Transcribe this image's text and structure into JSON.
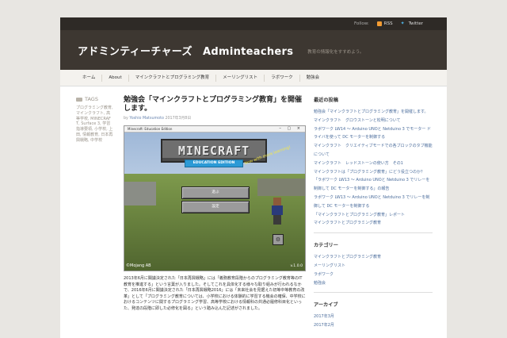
{
  "topbar": {
    "follow_label": "Follow:",
    "rss_label": "RSS",
    "twitter_label": "Twitter"
  },
  "header": {
    "title": "アドミンティーチャーズ　Adminteachers",
    "tagline": "教育の情報化をすすめよう。"
  },
  "nav": {
    "items": [
      "ホーム",
      "About",
      "マインクラフトとプログラミング教育",
      "メーリングリスト",
      "ラボワーク",
      "勉強会"
    ]
  },
  "tags": {
    "heading": "TAGS",
    "text": "プログラミング教育, マインクラフト, 高等学校, MINECRAFT, Surface 3, 学習指導要領, 小学校, 上田, 情報教育, 日本再興戦略, 中学校"
  },
  "post": {
    "title": "勉強会「マインクラフトとプログラミング教育」を開催します。",
    "meta_by": "by",
    "author": "Yoshio Matsumoto",
    "date": "2017年3月8日",
    "screenshot": {
      "window_title": "Minecraft: Education Edition",
      "logo_text": "MINECRAFT",
      "edition_text": "EDUCATION EDITION",
      "splash_text": "Now with more learning!",
      "play_button": "遊ぶ",
      "settings_button": "設定",
      "credit": "©Mojang AB",
      "version": "v.1.0.0"
    },
    "body": "2013年6月に閣議決定された「日本再興戦略」には「義務教育段階からのプログラミング教育等のIT教育を推進する」という言葉が入りました。そしてこれを具体化する様々な取り組みが行われるなかで、2016年6月に閣議決定された「日本再興戦略2016」には「未来社会を見据えた初等中等教育の改革」として「プログラミング教育については、小学校における体験的に学習する機会の確保、中学校におけるコンテンツに関するプログラミング学習、高等学校における情報科の共通必履修科目化といった、発達の段階に即した必修化を図る」という踏み込んだ記述がされました。"
  },
  "sidebar": {
    "recent_heading": "最近の投稿",
    "recent": [
      "勉強会「マインクラフトとプログラミング教育」を開催します。",
      "マインクラフト　グロウストーンと松明について",
      "ラボワーク LW14 ～ Arduino UNOと Netduino 3 でモーター ドライバを使って DC モーターを制御する",
      "マインクラフト　クリエイティブモードでの各ブロックのタブ機能について",
      "マインクラフト　レッドストーンの使い方　その1",
      "マインクラフトは「プログラミング教育」にどう役立つのか？",
      "「ラボワーク LW13 ～ Arduino UNOと Netduino 3 でリレーを制御して DC モーターを制御する」の報告",
      "ラボワーク LW13 ～ Arduino UNOと Netduino 3 でリレーを制御して DC モーターを制御する",
      "「マインクラフトとプログラミング教育」レポート",
      "マインクラフトとプログラミング教育"
    ],
    "category_heading": "カテゴリー",
    "categories": [
      "マインクラフトとプログラミング教育",
      "メーリングリスト",
      "ラボワーク",
      "勉強会"
    ],
    "archive_heading": "アーカイブ",
    "archives": [
      "2017年3月",
      "2017年2月"
    ]
  },
  "colors": {
    "header_bg": "#3d3731",
    "topbar_bg": "#2e2a26",
    "link": "#4b6d9c",
    "rss": "#f39c33",
    "twitter": "#4fb6e8"
  }
}
